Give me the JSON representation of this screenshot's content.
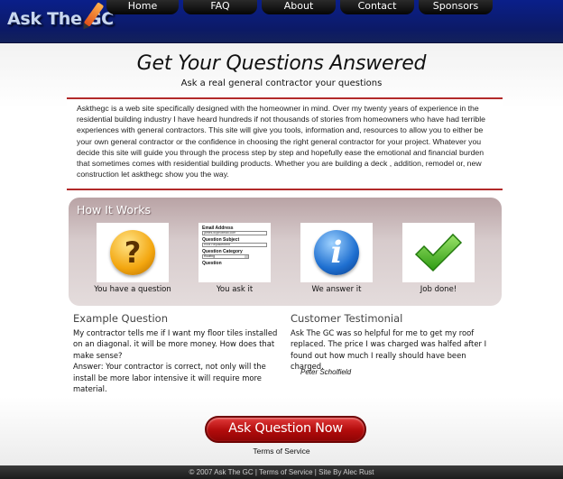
{
  "header": {
    "logo_text": "Ask The GC",
    "nav": [
      "Home",
      "FAQ",
      "About",
      "Contact",
      "Sponsors"
    ]
  },
  "main": {
    "title": "Get Your Questions Answered",
    "subtitle": "Ask a real general contractor your questions",
    "intro": "Askthegc is a web site specifically designed with the homeowner in mind. Over my twenty years of experience in the residential building industry I have heard hundreds if not thousands of stories from homeowners who have had terrible experiences with general contractors. This site will give you tools, information and, resources to allow you to either be your own general contractor or the confidence in choosing the right general contractor for your project. Whatever you decide this site will guide you through the process step by step and hopefully ease the emotional and financial burden that sometimes comes with residential building products. Whether you are building a deck , addition, remodel or, new construction let askthegc show you the way."
  },
  "how_it_works": {
    "title": "How It Works",
    "steps": [
      {
        "label": "You have a question",
        "icon": "question-icon",
        "glyph": "?"
      },
      {
        "label": "You ask it",
        "icon": "question-form"
      },
      {
        "label": "We answer it",
        "icon": "info-icon",
        "glyph": "i"
      },
      {
        "label": "Job done!",
        "icon": "checkmark-icon"
      }
    ],
    "form": {
      "email_label": "Email Address",
      "email_value": "james.w@hotmail.com",
      "subject_label": "Question Subject",
      "subject_value": "Roof Replacement",
      "category_label": "Question Category",
      "category_value": "Roofing",
      "question_label": "Question"
    }
  },
  "example": {
    "heading": "Example Question",
    "question": "My contractor tells me if I want my floor tiles installed on an diagonal. it will be more money. How does that make sense?",
    "answer": "Answer: Your contractor is correct, not only will the install be more labor intensive it will require more material."
  },
  "testimonial": {
    "heading": "Customer Testimonial",
    "text": "Ask The GC was so helpful for me to get my roof replaced. The price I was charged was halfed after I found out how much I really should have been charged.",
    "author": "Peter Scholfield"
  },
  "cta": {
    "button": "Ask Question Now",
    "tos": "Terms of Service"
  },
  "footer": {
    "text": "© 2007 Ask The GC | Terms of Service | Site By Alec Rust"
  },
  "colors": {
    "header_blue": "#0c1a66",
    "accent_red": "#b22a2a",
    "button_red": "#b10b0b",
    "panel_mauve": "#d7cbcc"
  }
}
